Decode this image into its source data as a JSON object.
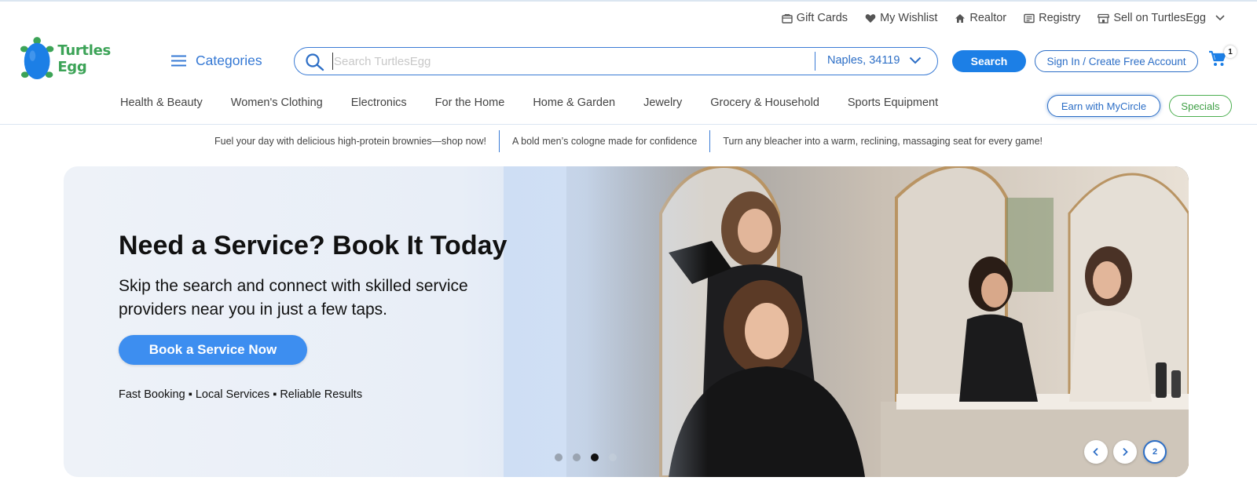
{
  "header": {
    "utility_links": [
      {
        "label": "Gift Cards",
        "icon": "gift-card-icon"
      },
      {
        "label": "My Wishlist",
        "icon": "heart-icon"
      },
      {
        "label": "Realtor",
        "icon": "house-icon"
      },
      {
        "label": "Registry",
        "icon": "registry-icon"
      },
      {
        "label": "Sell on TurtlesEgg",
        "icon": "store-icon"
      }
    ],
    "logo_text": "Turtles Egg",
    "categories_label": "Categories",
    "search": {
      "placeholder": "Search TurtlesEgg",
      "value": "",
      "location": "Naples, 34119",
      "button_label": "Search"
    },
    "signin_label": "Sign In / Create Free Account",
    "cart_count": "1",
    "colors": {
      "brand_blue": "#1c7fe6",
      "brand_green": "#3ca357",
      "link_blue": "#2c6ec6"
    }
  },
  "nav": {
    "items": [
      "Health & Beauty",
      "Women's Clothing",
      "Electronics",
      "For the Home",
      "Home & Garden",
      "Jewelry",
      "Grocery & Household",
      "Sports Equipment"
    ],
    "mycircle_label": "Earn with MyCircle",
    "specials_label": "Specials"
  },
  "promos": [
    "Fuel your day with delicious high-protein brownies—shop now!",
    "A bold men’s cologne made for confidence",
    "Turn any bleacher into a warm, reclining, massaging seat for every game!"
  ],
  "hero": {
    "title": "Need a Service? Book It Today",
    "subtitle": "Skip the search and connect with skilled service providers near you in just a few taps.",
    "cta_label": "Book a Service Now",
    "features": "Fast Booking ▪ Local Services ▪ Reliable Results",
    "carousel": {
      "slide_count": 4,
      "active_index": 2,
      "page_label": "2"
    }
  }
}
